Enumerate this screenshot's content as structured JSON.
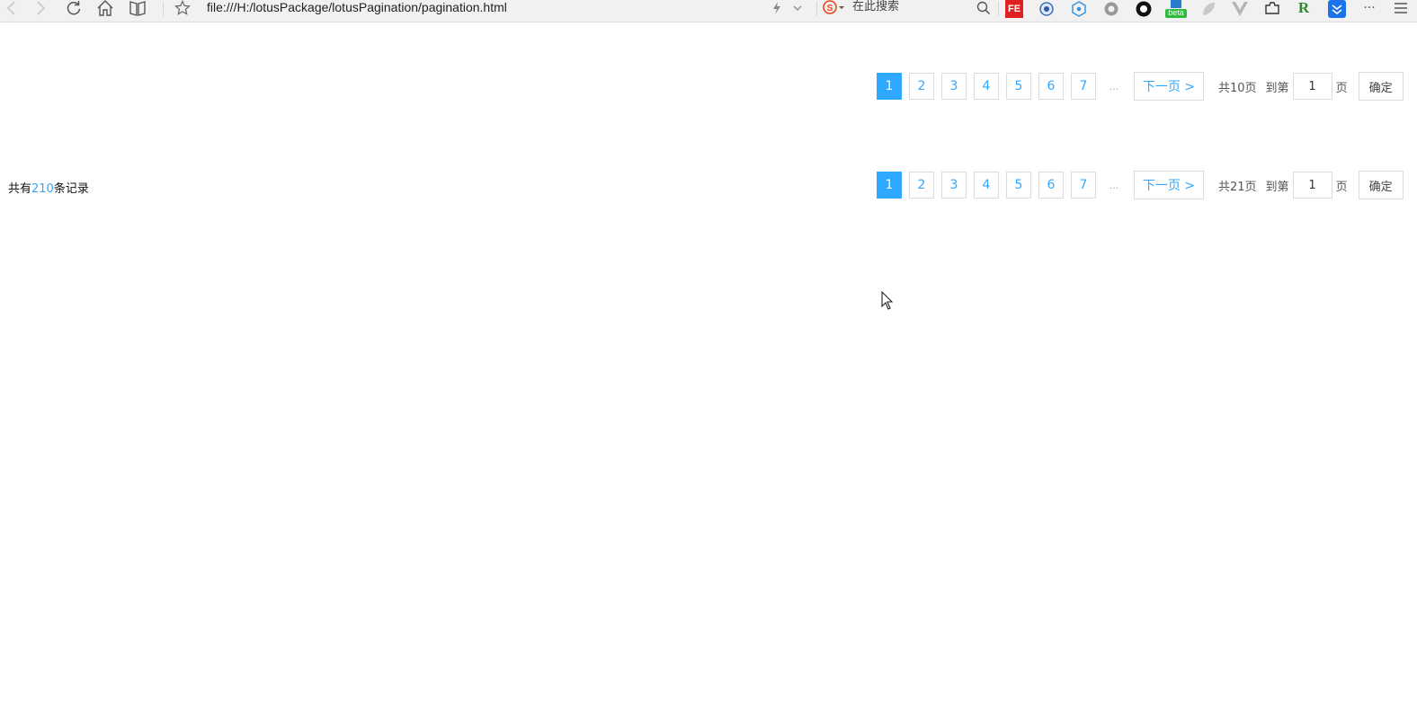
{
  "browser": {
    "address": "file:///H:/lotusPackage/lotusPagination/pagination.html",
    "search_placeholder": "在此搜索",
    "ext_beta_label": "beta",
    "ext_fe_label": "FE",
    "ext_r_label": "R",
    "more_label": "···",
    "icons": [
      "back-icon",
      "forward-icon",
      "reload-icon",
      "home-icon",
      "reading-view-icon",
      "favorite-star-icon",
      "lightning-icon",
      "dropdown-icon",
      "sogou-search-icon",
      "search-icon",
      "fe-helper-icon",
      "extension-icon",
      "extension-icon",
      "gear-icon",
      "circle-record-icon",
      "beta-extension-icon",
      "leaf-icon",
      "vue-devtools-icon",
      "screenshot-icon",
      "r-icon",
      "download-icon",
      "more-icon",
      "menu-icon"
    ]
  },
  "pager1": {
    "pages": [
      "1",
      "2",
      "3",
      "4",
      "5",
      "6",
      "7"
    ],
    "active": "1",
    "ellipsis": "...",
    "next_label": "下一页 >",
    "total_label": "共10页",
    "goto_label": "到第",
    "goto_value": "1",
    "page_label": "页",
    "ok_label": "确定"
  },
  "pager2": {
    "pages": [
      "1",
      "2",
      "3",
      "4",
      "5",
      "6",
      "7"
    ],
    "active": "1",
    "ellipsis": "...",
    "next_label": "下一页 >",
    "total_label": "共21页",
    "goto_label": "到第",
    "goto_value": "1",
    "page_label": "页",
    "ok_label": "确定"
  },
  "records": {
    "prefix": "共有",
    "count": "210",
    "suffix": "条记录"
  },
  "colors": {
    "accent": "#2fa8ff",
    "border": "#dcdcdc"
  }
}
